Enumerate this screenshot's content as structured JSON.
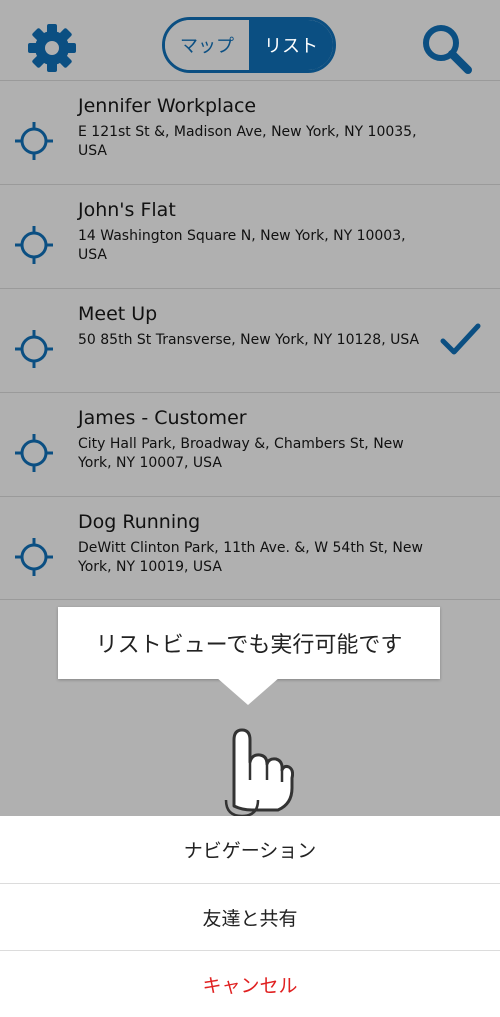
{
  "colors": {
    "accent": "#0b4f82",
    "overlay_bg": "#b0b0b0",
    "cancel": "#e02020"
  },
  "header": {
    "settings_icon": "gear-icon",
    "search_icon": "search-icon",
    "toggle": {
      "map_label": "マップ",
      "list_label": "リスト",
      "selected": "リスト"
    }
  },
  "locations": [
    {
      "name": "Jennifer Workplace",
      "address": "E 121st St &, Madison Ave, New York, NY 10035, USA",
      "selected": false
    },
    {
      "name": "John's Flat",
      "address": "14 Washington Square N, New York, NY 10003, USA",
      "selected": false
    },
    {
      "name": "Meet Up",
      "address": "50 85th St Transverse, New York, NY 10128, USA",
      "selected": true
    },
    {
      "name": "James - Customer",
      "address": "City Hall Park, Broadway &, Chambers St, New York, NY 10007, USA",
      "selected": false
    },
    {
      "name": "Dog Running",
      "address": "DeWitt Clinton Park, 11th Ave. &, W 54th St, New York, NY 10019, USA",
      "selected": false
    }
  ],
  "tooltip": {
    "text": "リストビューでも実行可能です"
  },
  "action_sheet": {
    "navigate_label": "ナビゲーション",
    "share_label": "友達と共有",
    "cancel_label": "キャンセル"
  }
}
